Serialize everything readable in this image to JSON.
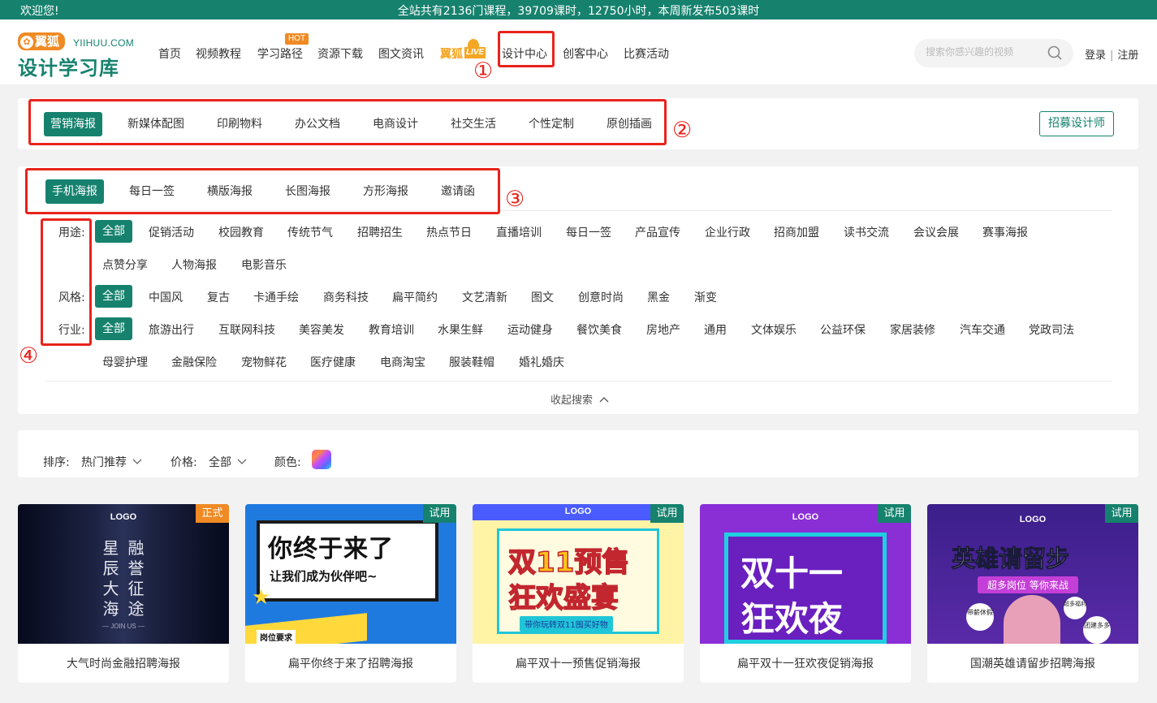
{
  "topbar": {
    "welcome": "欢迎您!",
    "stats": "全站共有2136门课程，39709课时，12750小时，本周新发布503课时"
  },
  "logo": {
    "badge": "翼狐",
    "domain": "YIIHUU.COM",
    "name": "设计学习库"
  },
  "nav": {
    "items": [
      "首页",
      "视频教程",
      "学习路径",
      "资源下载",
      "图文资讯",
      "设计中心",
      "创客中心",
      "比赛活动"
    ],
    "hot_badge": "HOT",
    "live_label": "翼狐",
    "live_badge": "LIVE"
  },
  "search": {
    "placeholder": "搜索你感兴趣的视频"
  },
  "auth": {
    "login": "登录",
    "separator": "|",
    "register": "注册"
  },
  "annotations": [
    "①",
    "②",
    "③",
    "④"
  ],
  "categories": {
    "items": [
      "营销海报",
      "新媒体配图",
      "印刷物料",
      "办公文档",
      "电商设计",
      "社交生活",
      "个性定制",
      "原创插画"
    ],
    "active": 0,
    "recruit_button": "招募设计师"
  },
  "subcategories": {
    "items": [
      "手机海报",
      "每日一签",
      "横版海报",
      "长图海报",
      "方形海报",
      "邀请函"
    ],
    "active": 0
  },
  "filters": {
    "usage": {
      "label": "用途:",
      "items": [
        "全部",
        "促销活动",
        "校园教育",
        "传统节气",
        "招聘招生",
        "热点节日",
        "直播培训",
        "每日一签",
        "产品宣传",
        "企业行政",
        "招商加盟",
        "读书交流",
        "会议会展",
        "赛事海报",
        "点赞分享",
        "人物海报",
        "电影音乐"
      ]
    },
    "style": {
      "label": "风格:",
      "items": [
        "全部",
        "中国风",
        "复古",
        "卡通手绘",
        "商务科技",
        "扁平简约",
        "文艺清新",
        "图文",
        "创意时尚",
        "黑金",
        "渐变"
      ]
    },
    "industry": {
      "label": "行业:",
      "items": [
        "全部",
        "旅游出行",
        "互联网科技",
        "美容美发",
        "教育培训",
        "水果生鲜",
        "运动健身",
        "餐饮美食",
        "房地产",
        "通用",
        "文体娱乐",
        "公益环保",
        "家居装修",
        "汽车交通",
        "党政司法",
        "母婴护理",
        "金融保险",
        "宠物鲜花",
        "医疗健康",
        "电商淘宝",
        "服装鞋帽",
        "婚礼婚庆"
      ]
    },
    "collapse": "收起搜索"
  },
  "sortbar": {
    "sort_label": "排序:",
    "sort_value": "热门推荐",
    "price_label": "价格:",
    "price_value": "全部",
    "color_label": "颜色:"
  },
  "cards": [
    {
      "title": "大气时尚金融招聘海报",
      "badge": "正式",
      "badge_color": "#f08a24",
      "logo": "LOGO",
      "thumb_lines": [
        "星",
        "融",
        "辰",
        "誉",
        "大",
        "征",
        "海",
        "途"
      ],
      "thumb_footer": "— JOIN US —"
    },
    {
      "title": "扁平你终于来了招聘海报",
      "badge": "试用",
      "badge_color": "#16826e",
      "thumb_main": "你终于来了",
      "thumb_sub": "让我们成为伙伴吧~",
      "thumb_tag": "岗位要求"
    },
    {
      "title": "扁平双十一预售促销海报",
      "badge": "试用",
      "badge_color": "#16826e",
      "logo": "LOGO",
      "thumb_main": "双11预售",
      "thumb_main2": "狂欢盛宴",
      "thumb_sub": "带你玩转双11囤买好物"
    },
    {
      "title": "扁平双十一狂欢夜促销海报",
      "badge": "试用",
      "badge_color": "#16826e",
      "logo": "LOGO",
      "thumb_main": "双十一",
      "thumb_main2": "狂欢夜"
    },
    {
      "title": "国潮英雄请留步招聘海报",
      "badge": "试用",
      "badge_color": "#16826e",
      "logo": "LOGO",
      "thumb_main": "英雄请留步",
      "thumb_sub": "超多岗位 等你来战",
      "thumb_bubbles": [
        "带薪休假",
        "超多福利",
        "团建多多"
      ]
    }
  ],
  "colors": {
    "brand": "#16826e",
    "accent": "#f08a24",
    "annotation": "#e8231c"
  }
}
